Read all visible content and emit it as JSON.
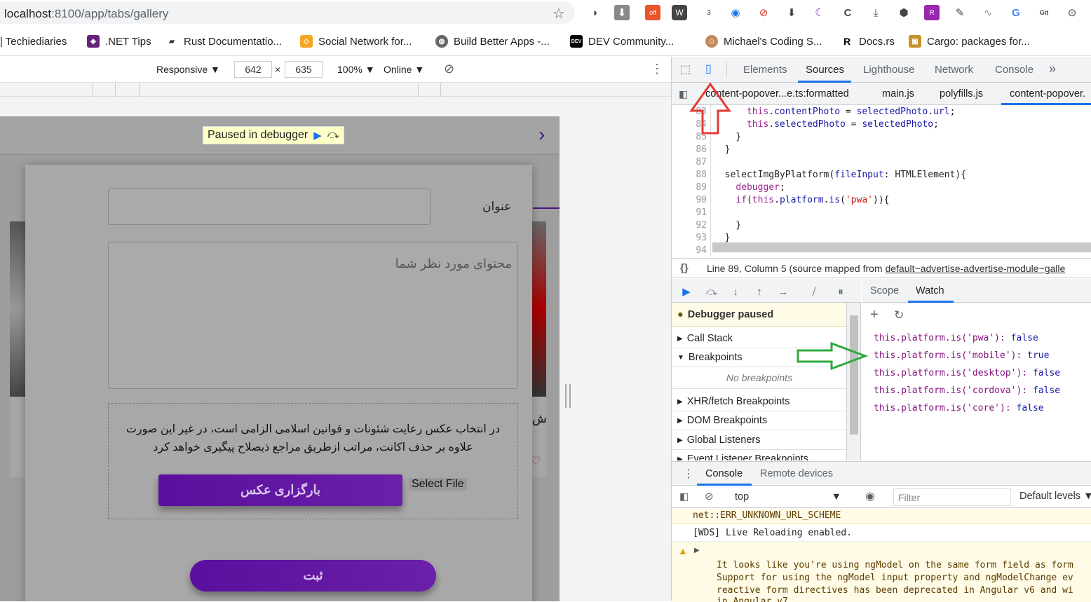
{
  "browser": {
    "url_host": "localhost",
    "url_rest": ":8100/app/tabs/gallery",
    "bookmarks": [
      {
        "label": "| Techiediaries",
        "color": "#ffffff"
      },
      {
        "label": ".NET Tips",
        "color": "#68217a"
      },
      {
        "label": "Rust Documentatio...",
        "color": "#333333"
      },
      {
        "label": "Social Network for...",
        "color": "#f5a623"
      },
      {
        "label": "Build Better Apps -...",
        "color": "#555555"
      },
      {
        "label": "DEV Community...",
        "color": "#000000"
      },
      {
        "label": "Michael's Coding S...",
        "color": "#c58a5b"
      },
      {
        "label": "Docs.rs",
        "color": "#000000"
      },
      {
        "label": "Cargo: packages for...",
        "color": "#c7922b"
      }
    ],
    "ext_badge_off": "off",
    "ext_badge_3": "3"
  },
  "device_toolbar": {
    "mode": "Responsive",
    "width": "642",
    "times": "×",
    "height": "635",
    "zoom": "100%",
    "network": "Online"
  },
  "app": {
    "paused_text": "Paused in debugger",
    "title_label": "عنوان",
    "content_placeholder": "محتوای مورد نظر شما",
    "notice_line1": "در انتخاب عکس رعایت شئونات و قوانین اسلامی الزامی است، در غیر این صورت",
    "notice_line2": "علاوه بر حذف اکانت، مراتب ازطریق مراجع ذیصلاح پیگیری خواهد کرد",
    "upload_button": "بارگزاری عکس",
    "select_file": "Select File",
    "submit_button": "ثبت",
    "side_text": "ش"
  },
  "devtools": {
    "tabs": [
      "Elements",
      "Sources",
      "Lighthouse",
      "Network",
      "Console"
    ],
    "more": "»",
    "file_tabs": [
      "content-popover...e.ts:formatted",
      "main.js",
      "polyfills.js",
      "content-popover."
    ],
    "code": [
      {
        "n": "83",
        "t": "      this.contentPhoto = selectedPhoto.url;"
      },
      {
        "n": "84",
        "t": "      this.selectedPhoto = selectedPhoto;"
      },
      {
        "n": "85",
        "t": "    }"
      },
      {
        "n": "86",
        "t": "  }"
      },
      {
        "n": "87",
        "t": ""
      },
      {
        "n": "88",
        "t": "  selectImgByPlatform(fileInput: HTMLElement){"
      },
      {
        "n": "89",
        "t": "    debugger;"
      },
      {
        "n": "90",
        "t": "    if(this.platform.is('pwa')){"
      },
      {
        "n": "91",
        "t": ""
      },
      {
        "n": "92",
        "t": "    }"
      },
      {
        "n": "93",
        "t": "  }"
      },
      {
        "n": "94",
        "t": ""
      }
    ],
    "status_prefix": "Line 89, Column 5  (source mapped from ",
    "status_link": "default~advertise-advertise-module~galle",
    "debugger_paused": "Debugger paused",
    "sections": [
      "Call Stack",
      "Breakpoints",
      "XHR/fetch Breakpoints",
      "DOM Breakpoints",
      "Global Listeners",
      "Event Listener Breakpoints"
    ],
    "no_breakpoints": "No breakpoints",
    "scope_tab": "Scope",
    "watch_tab": "Watch",
    "watches": [
      {
        "expr": "this.platform.is('pwa'): ",
        "val": "false"
      },
      {
        "expr": "this.platform.is('mobile'): ",
        "val": "true"
      },
      {
        "expr": "this.platform.is('desktop'): ",
        "val": "false"
      },
      {
        "expr": "this.platform.is('cordova'): ",
        "val": "false"
      },
      {
        "expr": "this.platform.is('core'): ",
        "val": "false"
      }
    ],
    "drawer_tabs": [
      "Console",
      "Remote devices"
    ],
    "context": "top",
    "filter_placeholder": "Filter",
    "levels": "Default levels",
    "console_lines": [
      "net::ERR_UNKNOWN_URL_SCHEME",
      "[WDS] Live Reloading enabled.",
      "It looks like you're using ngModel on the same form field as form",
      "Support for using the ngModel input property and ngModelChange ev",
      "reactive form directives has been deprecated in Angular v6 and wi",
      "in Angular v7."
    ]
  }
}
